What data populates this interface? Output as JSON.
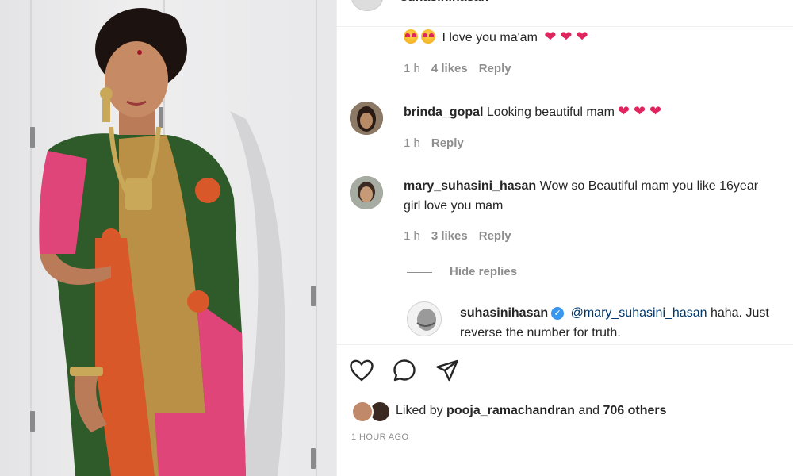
{
  "post": {
    "top_user": "suhasinihasan",
    "comments": [
      {
        "text": "I love you ma'am",
        "hearts": "❤ ❤ ❤",
        "time": "1 h",
        "likes": "4 likes",
        "reply": "Reply"
      },
      {
        "username": "brinda_gopal",
        "text": "Looking beautiful mam",
        "hearts": "❤ ❤ ❤",
        "time": "1 h",
        "reply": "Reply"
      },
      {
        "username": "mary_suhasini_hasan",
        "text_line1": "Wow so Beautiful mam you like 16year",
        "text_line2": "girl love you mam",
        "time": "1 h",
        "likes": "3 likes",
        "reply": "Reply",
        "hide_replies": "Hide replies"
      }
    ],
    "reply": {
      "username": "suhasinihasan",
      "mention": "@mary_suhasini_hasan",
      "text_line1": "haha. Just",
      "text_line2": "reverse the number for truth."
    },
    "liked_by_prefix": "Liked by",
    "liked_by_user": "pooja_ramachandran",
    "liked_by_and": "and",
    "liked_by_others": "706 others",
    "timestamp": "1 HOUR AGO"
  },
  "icons": {
    "like": "heart-outline-icon",
    "comment": "comment-bubble-icon",
    "share": "paper-plane-icon",
    "verified": "verified-badge-icon"
  },
  "colors": {
    "heart": "#e0245e",
    "verified": "#3897f0",
    "muted": "#8e8e8e",
    "saree_green": "#2f5a2a",
    "saree_pink": "#e0457a",
    "saree_gold": "#b99045"
  }
}
